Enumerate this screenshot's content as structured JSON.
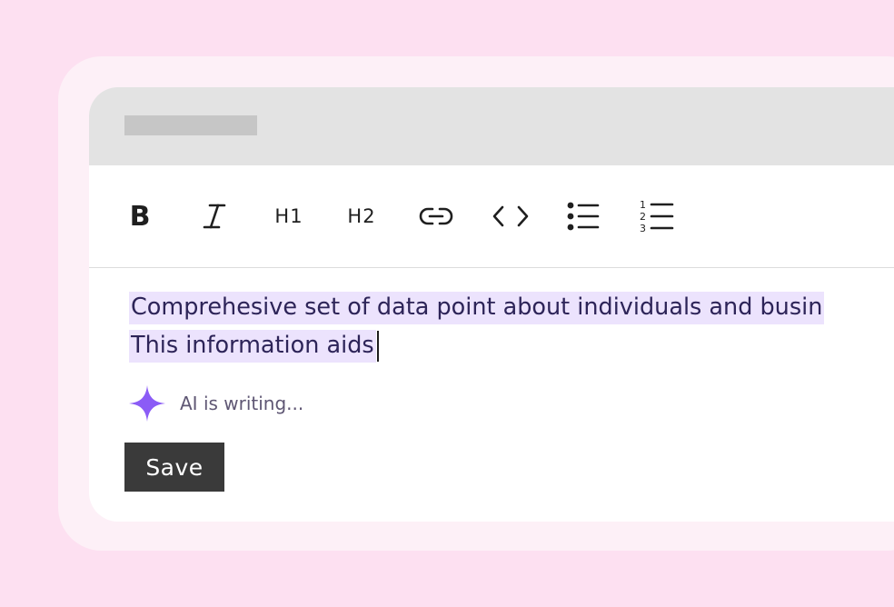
{
  "toolbar": {
    "bold_label": "B",
    "h1_label": "H1",
    "h2_label": "H2",
    "tools": [
      "bold-icon",
      "italic-icon",
      "heading-1",
      "heading-2",
      "link-icon",
      "code-icon",
      "bullet-list-icon",
      "numbered-list-icon"
    ]
  },
  "editor": {
    "line1": "Comprehesive set of data point about individuals and busin",
    "line2": "This information aids",
    "highlight_color": "#ece3fd",
    "text_color": "#2d2458"
  },
  "ai": {
    "status_text": "AI is writing...",
    "icon": "sparkle-icon",
    "accent_color": "#8b5cf6"
  },
  "actions": {
    "save_label": "Save"
  },
  "colors": {
    "page_background": "#fde0f1",
    "frame_background": "#fdf0f7",
    "title_bar": "#e3e3e3",
    "save_button": "#3a3a3a"
  }
}
